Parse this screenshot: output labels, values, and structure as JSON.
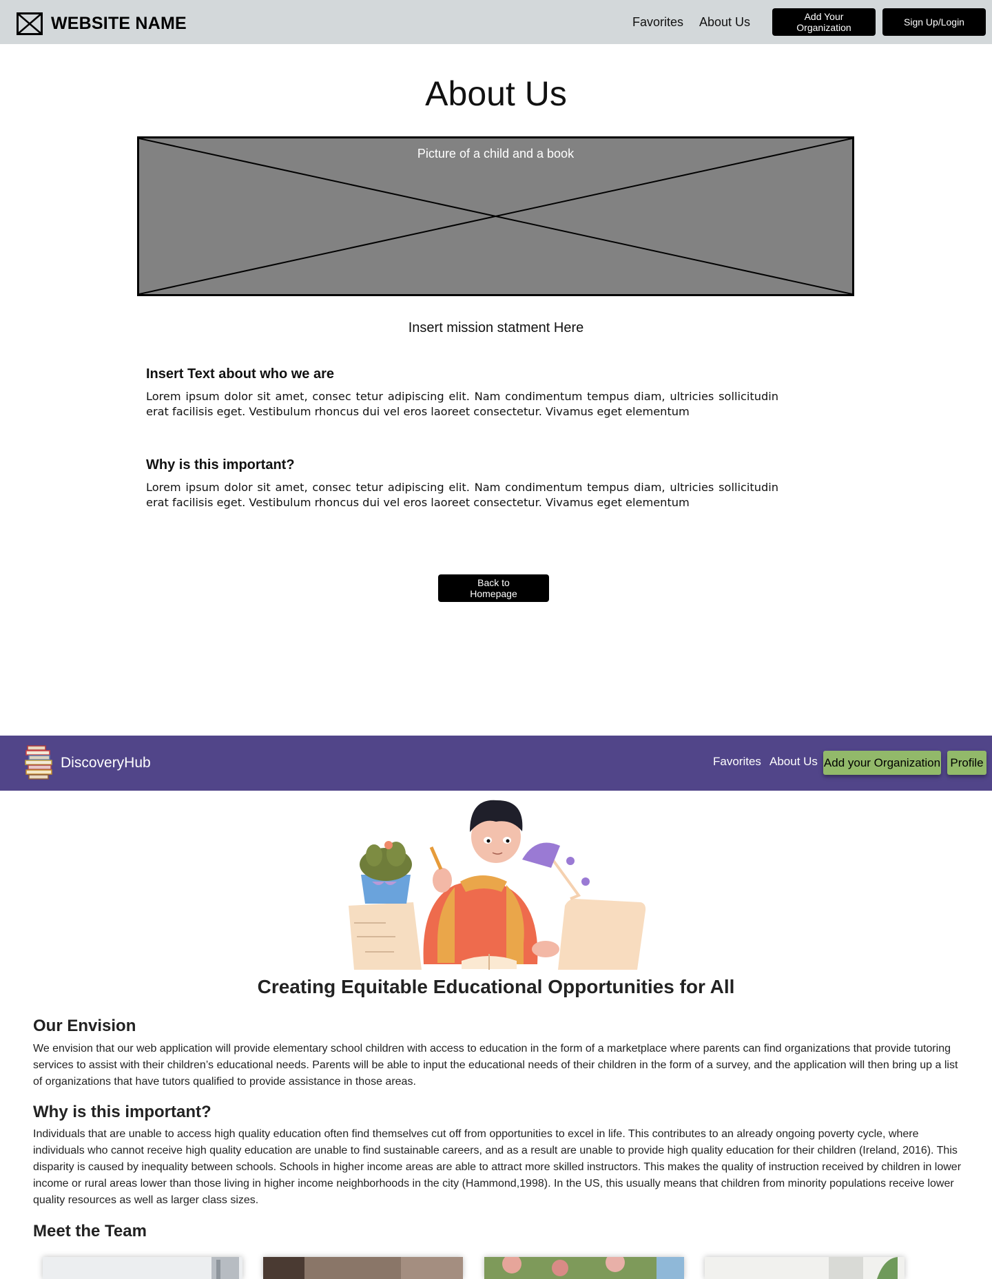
{
  "wireframe": {
    "header": {
      "site_name": "WEBSITE NAME",
      "logo_icon": "placeholder-image-icon",
      "nav": {
        "favorites": "Favorites",
        "about": "About Us"
      },
      "buttons": {
        "add_org": "Add Your Organization",
        "signup": "Sign Up/Login"
      },
      "bg_color": "#d3d8da"
    },
    "title": "About Us",
    "image_caption": "Picture of a child and a book",
    "mission": "Insert mission statment Here",
    "sections": [
      {
        "heading": "Insert Text about who we are",
        "text": "Lorem ipsum dolor sit amet, consec tetur adipiscing elit. Nam condimentum tempus diam, ultricies sollicitudin erat facilisis eget. Vestibulum rhoncus dui vel eros laoreet consectetur. Vivamus eget elementum"
      },
      {
        "heading": "Why is this important?",
        "text": "Lorem ipsum dolor sit amet, consec tetur adipiscing elit. Nam condimentum tempus diam, ultricies sollicitudin erat facilisis eget. Vestibulum rhoncus dui vel eros laoreet consectetur. Vivamus eget elementum"
      }
    ],
    "back_button": "Back to Homepage"
  },
  "final": {
    "nav": {
      "brand": "DiscoveryHub",
      "logo_icon": "books-stack-icon",
      "favorites": "Favorites",
      "about": "About Us",
      "add_org": "Add your Organization",
      "profile": "Profile",
      "bg_color": "#514589",
      "button_color": "#92b96a"
    },
    "illustration": "child-reading-illustration",
    "tagline": "Creating Equitable Educational Opportunities for All",
    "envision_heading": "Our Envision",
    "envision_text": "We envision that our web application will provide elementary school children with access to education in the form of a marketplace where parents can find organizations that provide tutoring services to assist with their children’s educational needs. Parents will be able to input the educational needs of their children in the form of a survey, and the application will then bring up a list of organizations that have tutors qualified to provide assistance in those areas.",
    "important_heading": "Why is this important?",
    "important_text": "Individuals that are unable to access high quality education often find themselves cut off from opportunities to excel in life. This contributes to an already ongoing poverty cycle, where individuals who cannot receive high quality education are unable to find sustainable careers, and as a result are unable to provide high quality education for their children (Ireland, 2016). This disparity is caused by inequality between schools. Schools in higher income areas are able to attract more skilled instructors. This makes the quality of instruction received by children in lower income or rural areas lower than those living in higher income neighborhoods in the city (Hammond,1998). In the US, this usually means that children from minority populations receive lower quality resources as well as larger class sizes.",
    "team_heading": "Meet the Team"
  }
}
